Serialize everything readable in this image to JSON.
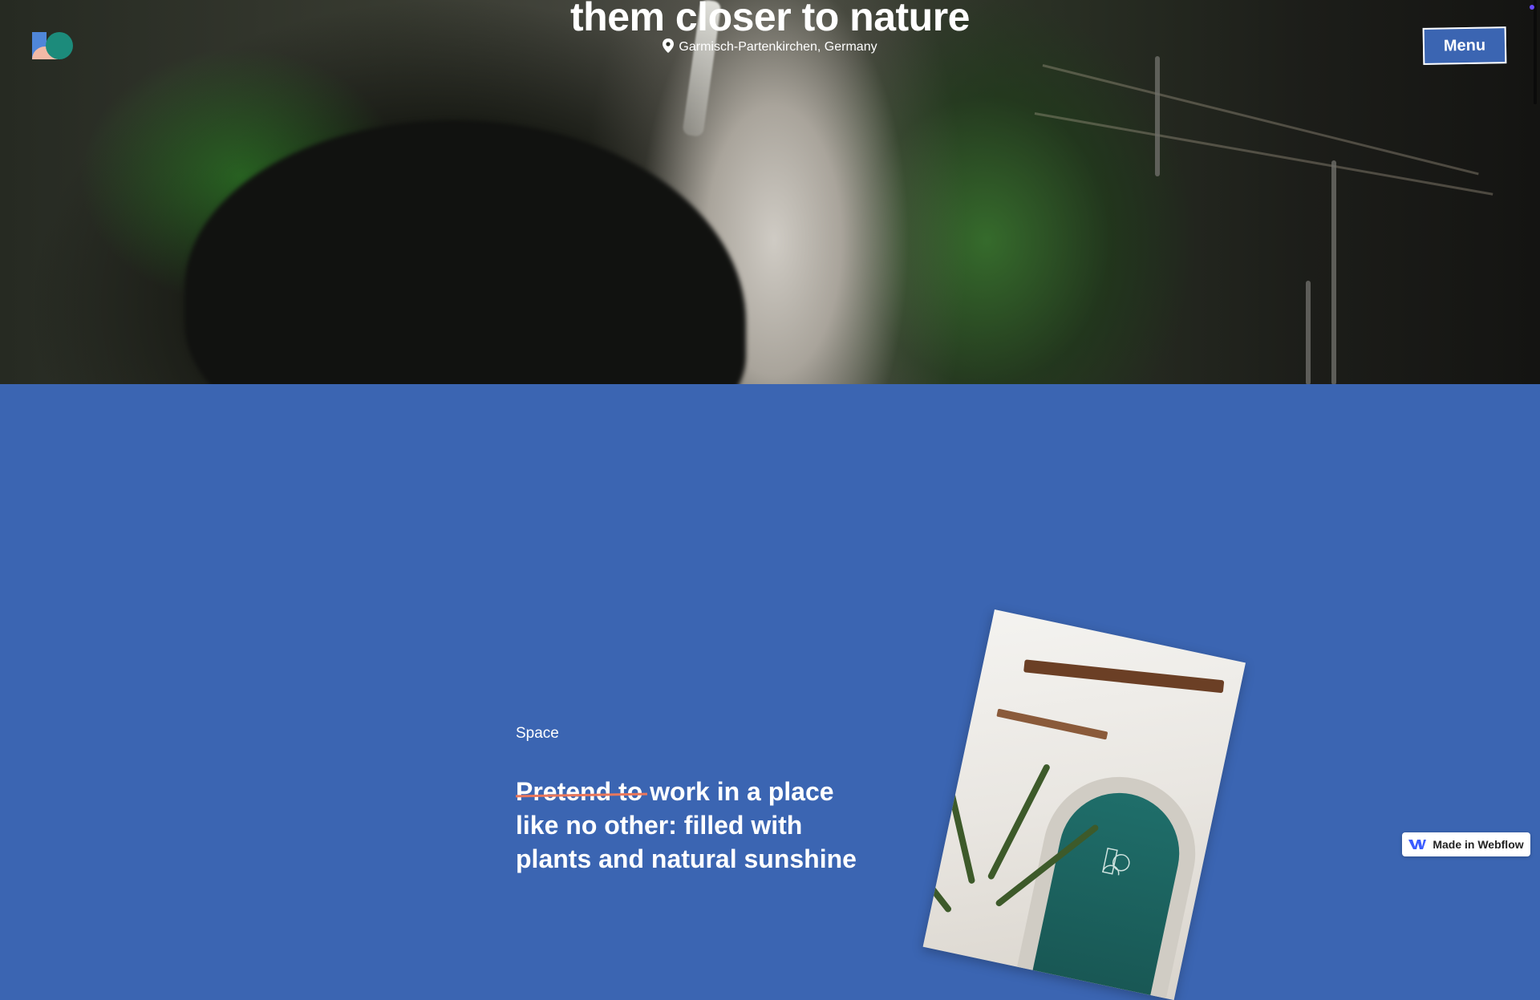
{
  "hero": {
    "title": "them closer to nature",
    "location": "Garmisch-Partenkirchen, Germany"
  },
  "header": {
    "menu_label": "Menu"
  },
  "section": {
    "eyebrow": "Space",
    "headline_struck": "Pretend to",
    "headline_rest": "work in a place like no other: filled with plants and natural sunshine"
  },
  "badge": {
    "label": "Made in Webflow"
  },
  "colors": {
    "section_bg": "#3b65b2",
    "strike": "#e9775c"
  },
  "icons": [
    "logo-icon",
    "location-pin-icon",
    "webflow-logo-icon"
  ]
}
